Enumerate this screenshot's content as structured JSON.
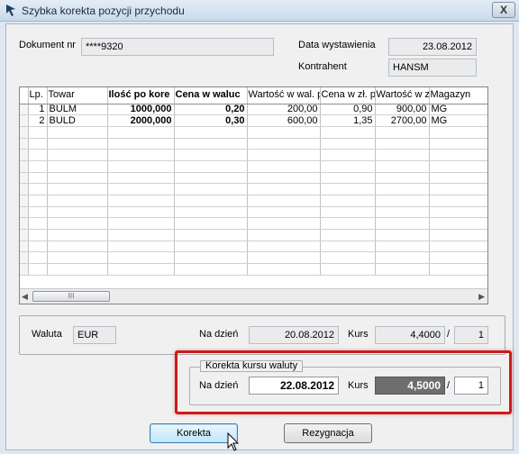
{
  "window": {
    "title": "Szybka korekta pozycji przychodu",
    "close_label": "X"
  },
  "header": {
    "dokument_label": "Dokument nr",
    "dokument_value": "****9320",
    "data_label": "Data wystawienia",
    "data_value": "23.08.2012",
    "kontrahent_label": "Kontrahent",
    "kontrahent_value": "HANSM"
  },
  "table": {
    "columns": [
      "Lp.",
      "Towar",
      "Ilość po kore",
      "Cena w waluc",
      "Wartość w wal. p",
      "Cena w zł. p",
      "Wartość w zł. p",
      "Magazyn"
    ],
    "rows": [
      [
        "1",
        "BULM",
        "1000,000",
        "0,20",
        "200,00",
        "0,90",
        "900,00",
        "MG"
      ],
      [
        "2",
        "BULD",
        "2000,000",
        "0,30",
        "600,00",
        "1,35",
        "2700,00",
        "MG"
      ]
    ],
    "scroll_thumb": "III"
  },
  "currency": {
    "waluta_label": "Waluta",
    "waluta_value": "EUR",
    "na_dzien_label": "Na dzień",
    "na_dzien_value": "20.08.2012",
    "kurs_label": "Kurs",
    "kurs_value": "4,4000",
    "separator": "/",
    "unit_value": "1"
  },
  "correction": {
    "group_title": "Korekta kursu waluty",
    "na_dzien_label": "Na dzień",
    "na_dzien_value": "22.08.2012",
    "kurs_label": "Kurs",
    "kurs_value": "4,5000",
    "separator": "/",
    "unit_value": "1"
  },
  "buttons": {
    "korekta": "Korekta",
    "rezygnacja": "Rezygnacja"
  },
  "colors": {
    "highlight": "#cc1b1b",
    "selected_field": "#6e6e6e"
  }
}
